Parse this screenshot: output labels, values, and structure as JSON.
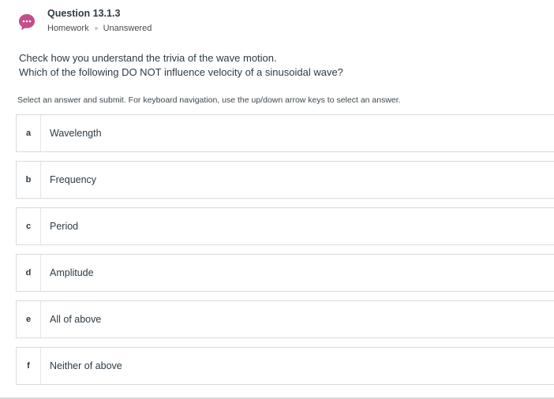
{
  "question": {
    "title": "Question 13.1.3",
    "type": "Homework",
    "status": "Unanswered",
    "icon": "chat-bubble-icon",
    "icon_color": "#c44d8a"
  },
  "prompt": {
    "line1": "Check how you understand the trivia of the wave motion.",
    "line2": "Which of the following DO NOT influence velocity of a sinusoidal wave?"
  },
  "instructions": "Select an answer and submit. For keyboard navigation, use the up/down arrow keys to select an answer.",
  "answers": [
    {
      "letter": "a",
      "text": "Wavelength"
    },
    {
      "letter": "b",
      "text": "Frequency"
    },
    {
      "letter": "c",
      "text": "Period"
    },
    {
      "letter": "d",
      "text": "Amplitude"
    },
    {
      "letter": "e",
      "text": "All of above"
    },
    {
      "letter": "f",
      "text": "Neither of above"
    }
  ]
}
